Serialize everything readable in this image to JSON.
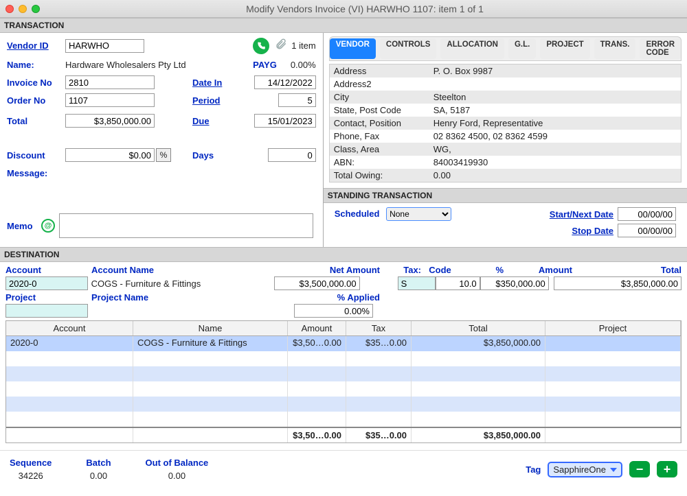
{
  "window_title": "Modify Vendors Invoice (VI) HARWHO 1107: item 1  of  1",
  "section": {
    "transaction": "TRANSACTION",
    "destination": "DESTINATION",
    "standing": "STANDING TRANSACTION"
  },
  "labels": {
    "vendor_id": "Vendor ID",
    "name": "Name:",
    "invoice_no": "Invoice No",
    "order_no": "Order No",
    "total": "Total",
    "discount": "Discount",
    "message": "Message:",
    "memo": "Memo",
    "date_in": "Date In",
    "period": "Period",
    "due": "Due",
    "days": "Days",
    "payg": "PAYG",
    "payg_pct": "0.00%",
    "item_count": "1 item"
  },
  "transaction": {
    "vendor_id": "HARWHO",
    "name": "Hardware Wholesalers Pty Ltd",
    "invoice_no": "2810",
    "order_no": "1107",
    "total": "$3,850,000.00",
    "discount": "$0.00",
    "message": "",
    "memo": "",
    "date_in": "14/12/2022",
    "period": "5",
    "due": "15/01/2023",
    "days": "0"
  },
  "tabs": [
    "VENDOR",
    "CONTROLS",
    "ALLOCATION",
    "G.L.",
    "PROJECT",
    "TRANS.",
    "ERROR CODE"
  ],
  "active_tab": 0,
  "vendor": {
    "rows": [
      [
        "Address",
        "P. O. Box 9987"
      ],
      [
        "Address2",
        ""
      ],
      [
        "City",
        "Steelton"
      ],
      [
        "State, Post Code",
        "SA, 5187"
      ],
      [
        "Contact, Position",
        "Henry Ford, Representative"
      ],
      [
        "Phone, Fax",
        "02 8362 4500, 02 8362 4599"
      ],
      [
        "Class, Area",
        "WG,"
      ],
      [
        "ABN:",
        "84003419930"
      ],
      [
        "Total Owing:",
        "0.00"
      ]
    ]
  },
  "standing": {
    "scheduled_label": "Scheduled",
    "scheduled_value": "None",
    "start_label": "Start/Next Date",
    "start_value": "00/00/00",
    "stop_label": "Stop Date",
    "stop_value": "00/00/00"
  },
  "dest_labels": {
    "account": "Account",
    "account_name": "Account Name",
    "net_amount": "Net Amount",
    "tax": "Tax:",
    "code": "Code",
    "pct": "%",
    "amount": "Amount",
    "total": "Total",
    "project": "Project",
    "project_name": "Project Name",
    "pct_applied": "% Applied"
  },
  "dest_entry": {
    "account": "2020-0",
    "account_name": "COGS - Furniture & Fittings",
    "net_amount": "$3,500,000.00",
    "tax_code": "S",
    "tax_pct": "10.0",
    "tax_amount": "$350,000.00",
    "total": "$3,850,000.00",
    "project": "",
    "project_name": "",
    "pct_applied": "0.00%"
  },
  "table": {
    "headers": [
      "Account",
      "Name",
      "Amount",
      "Tax",
      "Total",
      "Project"
    ],
    "rows": [
      [
        "2020-0",
        "COGS - Furniture & Fittings",
        "$3,50…0.00",
        "$35…0.00",
        "$3,850,000.00",
        ""
      ]
    ],
    "footer": [
      "",
      "",
      "$3,50…0.00",
      "$35…0.00",
      "$3,850,000.00",
      ""
    ]
  },
  "footer": {
    "sequence_label": "Sequence",
    "sequence": "34226",
    "batch_label": "Batch",
    "batch": "0.00",
    "oob_label": "Out of Balance",
    "oob": "0.00",
    "tag_label": "Tag",
    "tag_value": "SapphireOne"
  }
}
